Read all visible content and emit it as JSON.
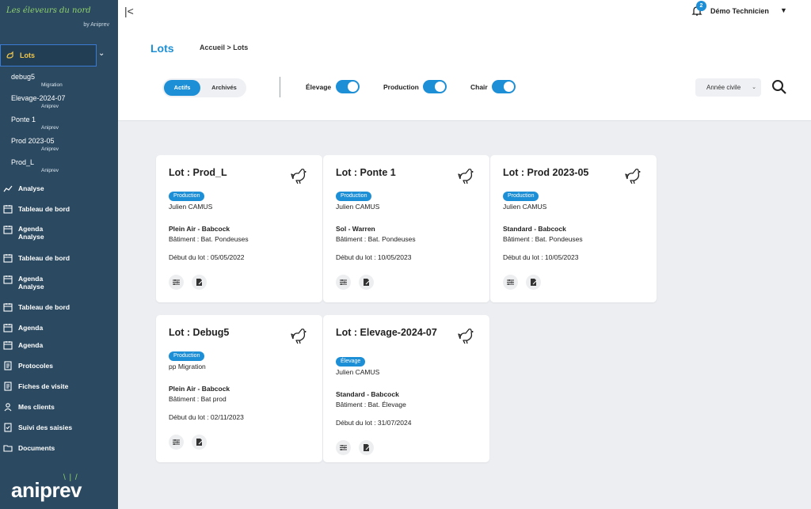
{
  "sidebar": {
    "brand_title": "Les éleveurs du nord",
    "brand_sub": "by Aniprev",
    "active_label": "Lots",
    "lots": [
      {
        "name": "debug5",
        "owner": "Migration"
      },
      {
        "name": "Elevage-2024-07",
        "owner": "Aniprev"
      },
      {
        "name": "Ponte 1",
        "owner": "Aniprev"
      },
      {
        "name": "Prod 2023-05",
        "owner": "Aniprev"
      },
      {
        "name": "Prod_L",
        "owner": "Aniprev"
      }
    ],
    "nav": [
      "Analyse",
      "Tableau de bord",
      "Agenda",
      "Analyse",
      "Tableau de bord",
      "Agenda",
      "Analyse",
      "Tableau de bord",
      "Agenda",
      "Agenda",
      "Protocoles",
      "Fiches de visite",
      "Mes clients",
      "Suivi des saisies",
      "Documents"
    ],
    "logo": "aniprev"
  },
  "header": {
    "notif_count": "2",
    "user": "Démo Technicien",
    "title": "Lots",
    "breadcrumb": "Accueil  >  Lots",
    "tabs": [
      "Actifs",
      "Archivés"
    ],
    "toggles": [
      "Élevage",
      "Production",
      "Chair"
    ],
    "year_select": "Année civile",
    "accent": "#1d8fd6"
  },
  "cards": [
    {
      "title": "Lot : Prod_L",
      "badge": "Production",
      "owner": "Julien CAMUS",
      "type": "Plein Air - Babcock",
      "building": "Bâtiment : Bat. Pondeuses",
      "start": "Début du lot : 05/05/2022"
    },
    {
      "title": "Lot : Ponte 1",
      "badge": "Production",
      "owner": "Julien CAMUS",
      "type": "Sol - Warren",
      "building": "Bâtiment : Bat. Pondeuses",
      "start": "Début du lot : 10/05/2023"
    },
    {
      "title": "Lot : Prod 2023-05",
      "badge": "Production",
      "owner": "Julien CAMUS",
      "type": "Standard - Babcock",
      "building": "Bâtiment : Bat. Pondeuses",
      "start": "Début du lot : 10/05/2023"
    },
    {
      "title": "Lot : Debug5",
      "badge": "Production",
      "owner": "pp Migration",
      "type": "Plein Air - Babcock",
      "building": "Bâtiment : Bat prod",
      "start": "Début du lot : 02/11/2023"
    },
    {
      "title": "Lot : Elevage-2024-07",
      "badge": "Élevage",
      "owner": "Julien CAMUS",
      "type": "Standard - Babcock",
      "building": "Bâtiment : Bat. Élevage",
      "start": "Début du lot : 31/07/2024"
    }
  ]
}
